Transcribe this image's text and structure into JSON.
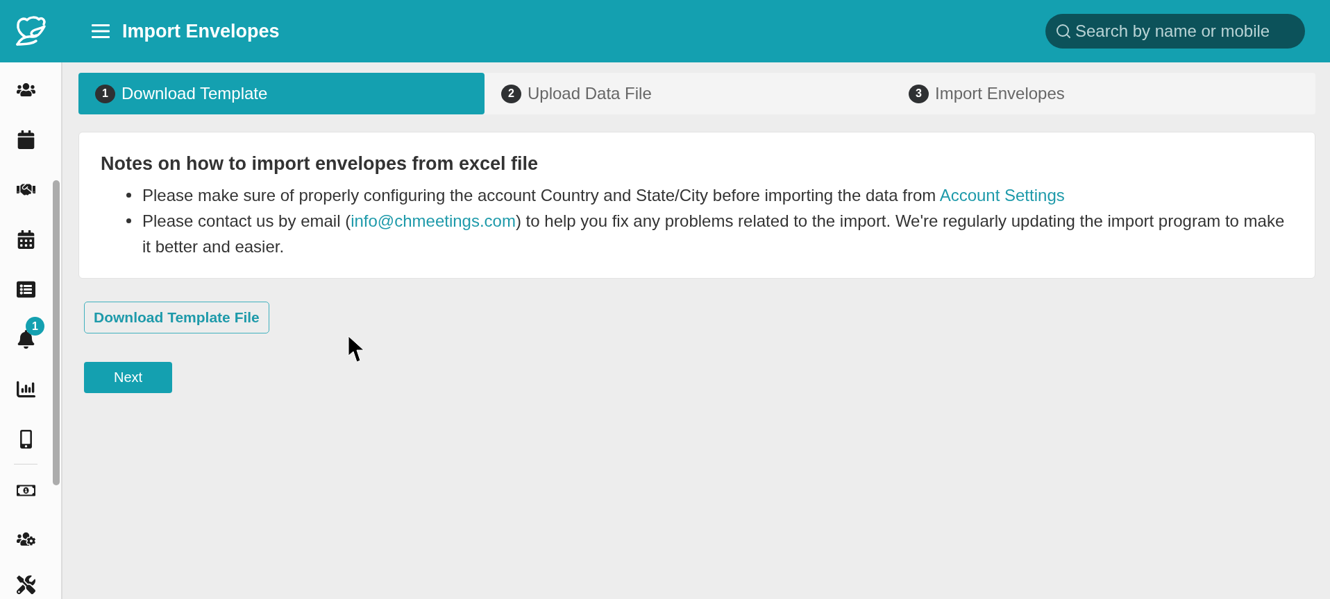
{
  "header": {
    "title": "Import Envelopes",
    "search": {
      "placeholder": "Search by name or mobile"
    }
  },
  "sidebar": {
    "notification_count": "1"
  },
  "steps": [
    {
      "number": "1",
      "label": "Download Template",
      "selected": true
    },
    {
      "number": "2",
      "label": "Upload Data File",
      "selected": false
    },
    {
      "number": "3",
      "label": "Import Envelopes",
      "selected": false
    }
  ],
  "notes": {
    "title": "Notes on how to import envelopes from excel file",
    "items": [
      {
        "parts": [
          {
            "kind": "text",
            "text": "Please make sure of properly configuring the account Country and State/City before importing the data from "
          },
          {
            "kind": "link",
            "text": "Account Settings"
          }
        ]
      },
      {
        "parts": [
          {
            "kind": "text",
            "text": "Please contact us by email ("
          },
          {
            "kind": "link",
            "text": "info@chmeetings.com"
          },
          {
            "kind": "text",
            "text": ") to help you fix any problems related to the import. We're regularly updating the import program to make it better and easier."
          }
        ]
      }
    ]
  },
  "buttons": {
    "download_template": "Download Template File",
    "next": "Next"
  }
}
